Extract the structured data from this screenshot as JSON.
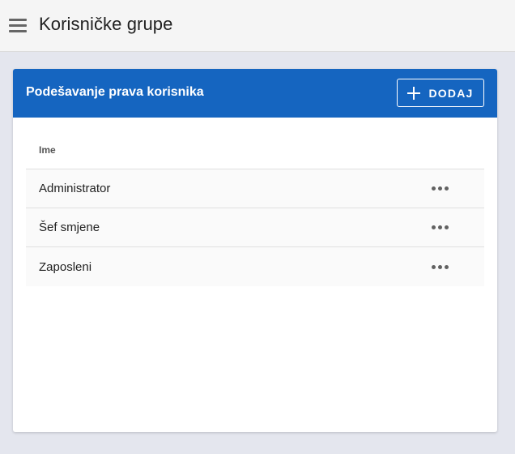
{
  "header": {
    "title": "Korisničke grupe",
    "menu_icon": "hamburger-menu-icon"
  },
  "card": {
    "title": "Podešavanje prava korisnika",
    "add_button_label": "DODAJ",
    "add_icon": "plus-icon"
  },
  "table": {
    "column_header": "Ime",
    "rows": [
      {
        "name": "Administrator",
        "action_icon": "more-horizontal-icon"
      },
      {
        "name": "Šef smjene",
        "action_icon": "more-horizontal-icon"
      },
      {
        "name": "Zaposleni",
        "action_icon": "more-horizontal-icon"
      }
    ]
  },
  "colors": {
    "accent": "#1565c0",
    "background": "#e4e6ee",
    "topbar": "#f5f5f5"
  }
}
